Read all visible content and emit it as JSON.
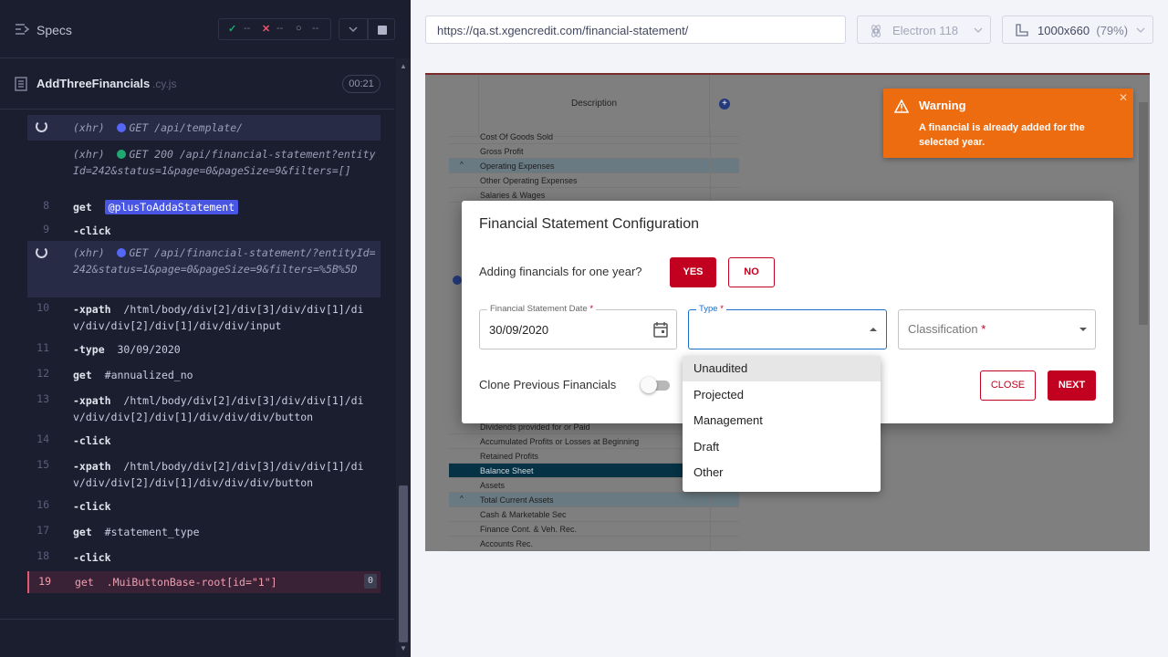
{
  "runner": {
    "specs_label": "Specs",
    "stats": {
      "passed": "--",
      "failed": "--",
      "pending": "--"
    },
    "spec": {
      "name": "AddThreeFinancials",
      "ext": ".cy.js",
      "duration": "00:21"
    },
    "log": {
      "xhr1": {
        "type": "(xhr)",
        "text": "GET /api/template/"
      },
      "xhr2": {
        "type": "(xhr)",
        "text": "GET 200 /api/financial-statement?entityId=242&status=1&page=0&pageSize=9&filters=[]"
      },
      "l8": {
        "num": "8",
        "cmd": "get",
        "arg": "@plusToAddaStatement"
      },
      "l9": {
        "num": "9",
        "cmd": "-click"
      },
      "xhr3": {
        "type": "(xhr)",
        "text": "GET /api/financial-statement/?entityId=242&status=1&page=0&pageSize=9&filters=%5B%5D"
      },
      "l10": {
        "num": "10",
        "cmd": "-xpath",
        "arg": "/html/body/div[2]/div[3]/div/div[1]/div/div/div[2]/div[1]/div/div/input"
      },
      "l11": {
        "num": "11",
        "cmd": "-type",
        "arg": "30/09/2020"
      },
      "l12": {
        "num": "12",
        "cmd": "get",
        "arg": "#annualized_no"
      },
      "l13": {
        "num": "13",
        "cmd": "-xpath",
        "arg": "/html/body/div[2]/div[3]/div/div[1]/div/div/div[2]/div[1]/div/div/div/button"
      },
      "l14": {
        "num": "14",
        "cmd": "-click"
      },
      "l15": {
        "num": "15",
        "cmd": "-xpath",
        "arg": "/html/body/div[2]/div[3]/div/div[1]/div/div/div[2]/div[1]/div/div/div/button"
      },
      "l16": {
        "num": "16",
        "cmd": "-click"
      },
      "l17": {
        "num": "17",
        "cmd": "get",
        "arg": "#statement_type"
      },
      "l18": {
        "num": "18",
        "cmd": "-click"
      },
      "l19": {
        "num": "19",
        "cmd": "get",
        "arg": ".MuiButtonBase-root[id=\"1\"]",
        "count": "0"
      }
    }
  },
  "browser": {
    "url": "https://qa.st.xgencredit.com/financial-statement/",
    "browser_name": "Electron 118",
    "viewport": "1000x660",
    "zoom": "(79%)"
  },
  "app": {
    "table_header": "Description",
    "table_rows": [
      "Cost Of Goods Sold",
      "Gross Profit",
      "Operating Expenses",
      "Other Operating Expenses",
      "Salaries & Wages"
    ],
    "table_rows_bottom": [
      "Dividends provided for or Paid",
      "Accumulated Profits or Losses at Beginning",
      "Retained Profits",
      "Balance Sheet",
      "Assets",
      "Total Current Assets",
      "Cash & Marketable Sec",
      "Finance Cont. & Veh. Rec.",
      "Accounts Rec."
    ],
    "toast": {
      "title": "Warning",
      "message": "A financial is already added for the selected year."
    },
    "modal": {
      "title": "Financial Statement Configuration",
      "question": "Adding financials for one year?",
      "yes": "YES",
      "no": "NO",
      "date_label": "Financial Statement Date",
      "date_value": "30/09/2020",
      "type_label": "Type",
      "classification_label": "Classification",
      "required_mark": "*",
      "clone_label": "Clone Previous Financials",
      "close": "CLOSE",
      "next": "NEXT"
    },
    "type_options": [
      "Unaudited",
      "Projected",
      "Management",
      "Draft",
      "Other"
    ],
    "selected_option": "Unaudited"
  }
}
